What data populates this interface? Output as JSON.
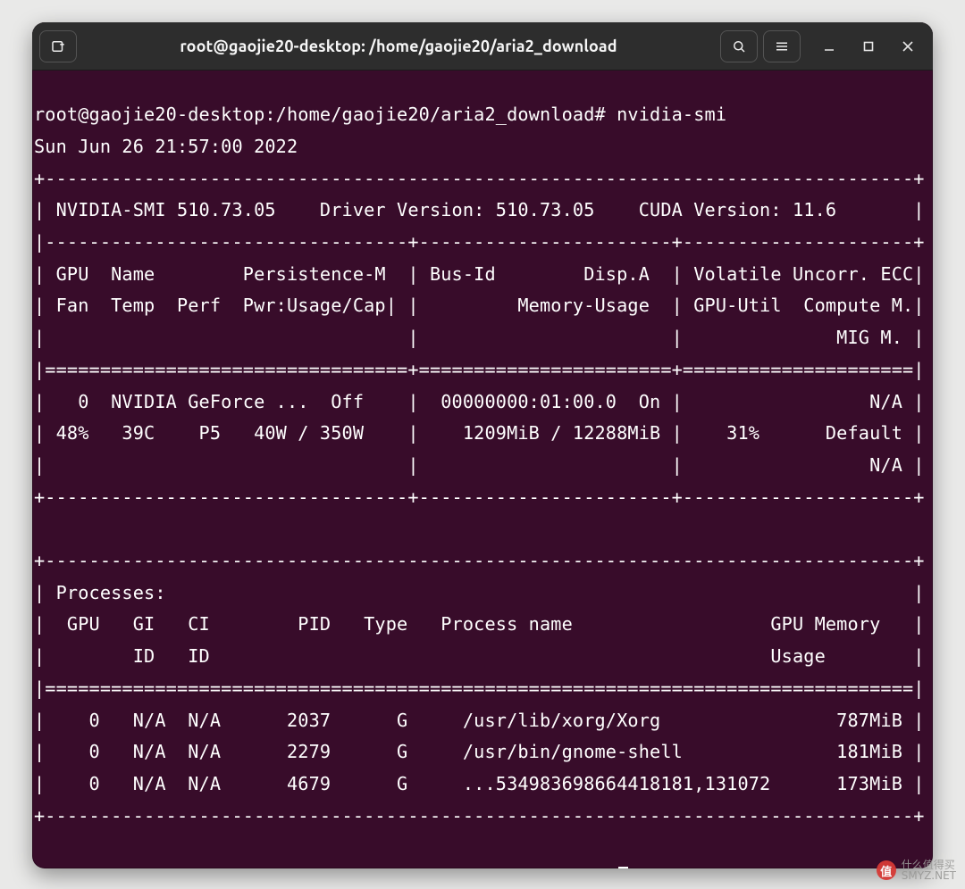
{
  "window": {
    "title": "root@gaojie20-desktop: /home/gaojie20/aria2_download"
  },
  "prompt": {
    "user_host": "root@gaojie20-desktop",
    "path": "/home/gaojie20/aria2_download",
    "symbol": "#",
    "command": "nvidia-smi"
  },
  "timestamp": "Sun Jun 26 21:57:00 2022",
  "smi": {
    "version": "510.73.05",
    "driver_version": "510.73.05",
    "cuda_version": "11.6",
    "gpu": {
      "index": "0",
      "name": "NVIDIA GeForce ...",
      "persistence": "Off",
      "bus_id": "00000000:01:00.0",
      "disp_a": "On",
      "ecc": "N/A",
      "fan": "48%",
      "temp": "39C",
      "perf": "P5",
      "power": "40W / 350W",
      "memory": "1209MiB / 12288MiB",
      "gpu_util": "31%",
      "compute_mode": "Default",
      "mig_mode": "N/A"
    },
    "processes": [
      {
        "gpu": "0",
        "gi": "N/A",
        "ci": "N/A",
        "pid": "2037",
        "type": "G",
        "name": "/usr/lib/xorg/Xorg",
        "mem": "787MiB"
      },
      {
        "gpu": "0",
        "gi": "N/A",
        "ci": "N/A",
        "pid": "2279",
        "type": "G",
        "name": "/usr/bin/gnome-shell",
        "mem": "181MiB"
      },
      {
        "gpu": "0",
        "gi": "N/A",
        "ci": "N/A",
        "pid": "4679",
        "type": "G",
        "name": "...534983698664418181,131072",
        "mem": "173MiB"
      }
    ]
  },
  "watermark": {
    "brand": "什么值得买",
    "site": "SMYZ.NET"
  }
}
